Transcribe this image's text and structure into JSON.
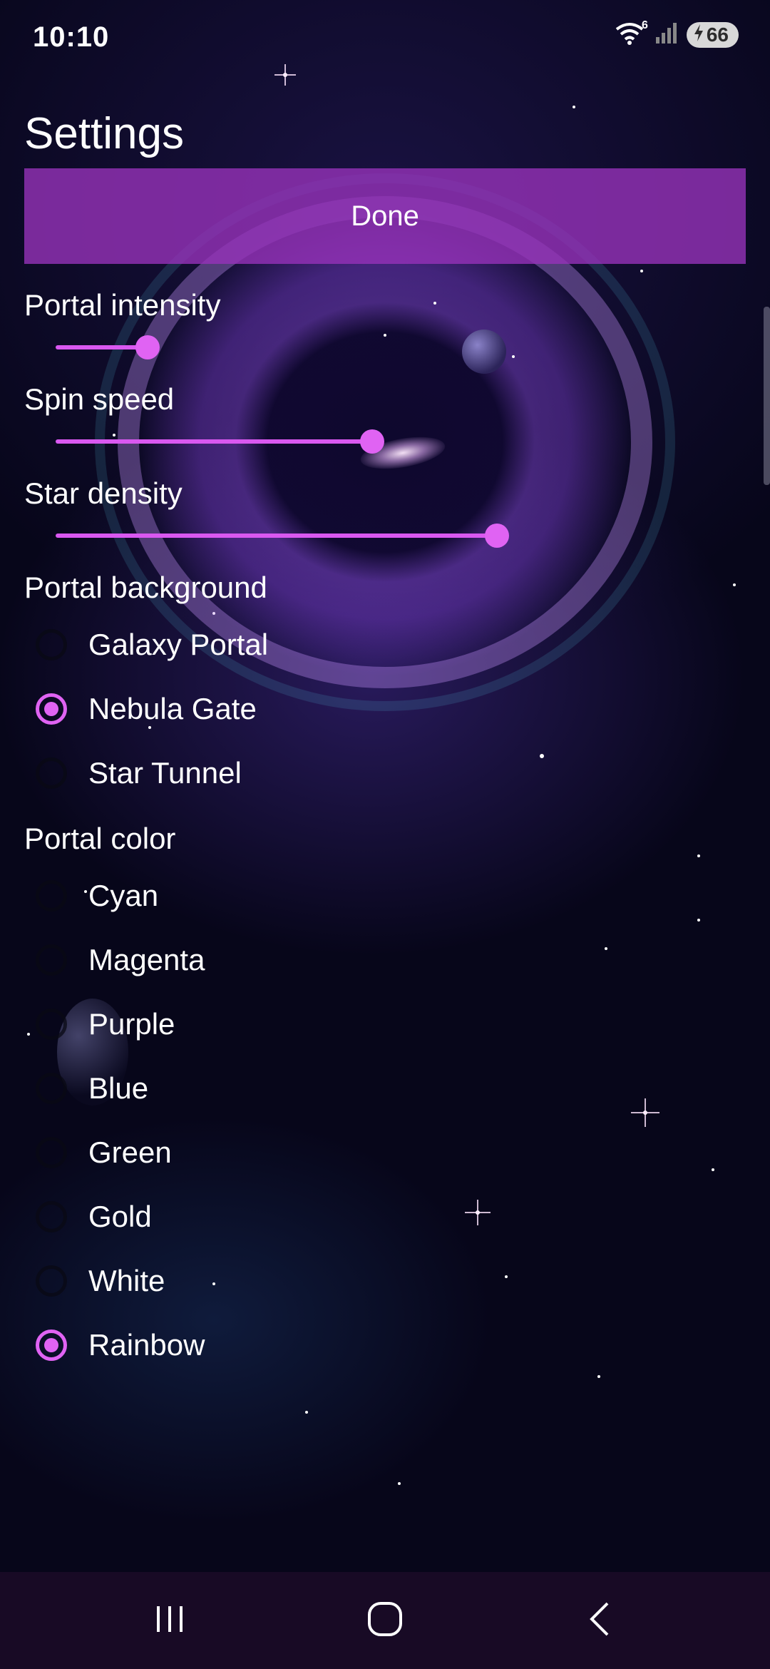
{
  "status_bar": {
    "time": "10:10",
    "wifi_badge": "6",
    "battery_level": "66",
    "icons": [
      "wifi-icon",
      "signal-icon",
      "battery-charging-icon"
    ]
  },
  "settings": {
    "title": "Settings",
    "done_label": "Done",
    "sliders": [
      {
        "label": "Portal intensity",
        "level": 0.14
      },
      {
        "label": "Spin speed",
        "level": 0.48
      },
      {
        "label": "Star density",
        "level": 0.67
      }
    ],
    "portal_background": {
      "heading": "Portal background",
      "options": [
        "Galaxy Portal",
        "Nebula Gate",
        "Star Tunnel"
      ],
      "selected": "Nebula Gate"
    },
    "portal_color": {
      "heading": "Portal color",
      "options": [
        "Cyan",
        "Magenta",
        "Purple",
        "Blue",
        "Green",
        "Gold",
        "White",
        "Rainbow"
      ],
      "selected": "Rainbow"
    }
  },
  "nav_bar": {
    "icons": [
      "recents-icon",
      "home-icon",
      "back-icon"
    ]
  },
  "colors": {
    "accent": "#e063f3",
    "done_button_bg": "#9632b9",
    "nav_bar_bg": "#180a25",
    "background": "#07061a"
  }
}
